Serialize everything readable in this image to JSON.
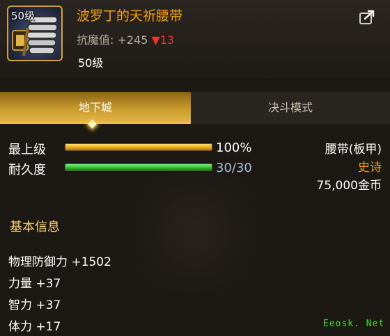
{
  "item": {
    "icon_level": "50级",
    "name": "波罗丁的天祈腰带",
    "stat_label": "抗魔值:",
    "stat_value": "+245",
    "stat_change_arrow": "▼",
    "stat_change": "13",
    "level": "50级",
    "icon": "belt-icon",
    "share_icon": "share-icon"
  },
  "tabs": [
    {
      "label": "地下城",
      "active": true
    },
    {
      "label": "决斗模式",
      "active": false
    }
  ],
  "bars": {
    "max_level": {
      "label": "最上级",
      "value": "100%",
      "fraction": 1.0
    },
    "durability": {
      "label": "耐久度",
      "value": "30/30",
      "fraction": 1.0
    }
  },
  "info": {
    "type": "腰带(板甲)",
    "rarity": "史诗",
    "price": "75,000金币"
  },
  "basic": {
    "title": "基本信息",
    "props": [
      "物理防御力 +1502",
      "力量 +37",
      "智力 +37",
      "体力 +17"
    ]
  },
  "watermark": "Eeosk. Net",
  "colors": {
    "accent": "#f2a31a",
    "decrease": "#e83a2e",
    "durability_green": "#2fb82a"
  }
}
